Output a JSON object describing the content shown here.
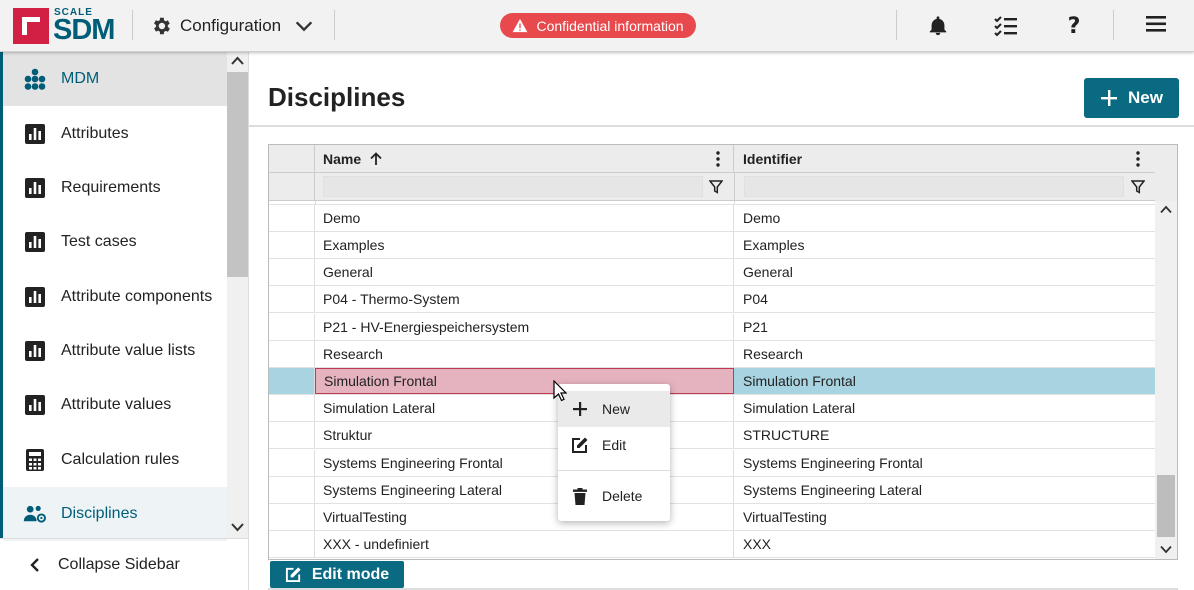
{
  "brand": {
    "scale": "SCALE",
    "sdm": "SDM",
    "color": "#005d77",
    "mark_color": "#d21f44"
  },
  "header": {
    "module_label": "Configuration",
    "confidential_label": "Confidential information",
    "icons": [
      "gear-icon",
      "chevron-down-icon",
      "warning-icon",
      "bell-icon",
      "tasks-icon",
      "help-icon",
      "menu-icon"
    ]
  },
  "sidebar": {
    "items": [
      {
        "label": "MDM",
        "icon": "sitemap-icon"
      },
      {
        "label": "Attributes",
        "icon": "chart-icon"
      },
      {
        "label": "Requirements",
        "icon": "chart-icon"
      },
      {
        "label": "Test cases",
        "icon": "chart-icon"
      },
      {
        "label": "Attribute components",
        "icon": "chart-icon"
      },
      {
        "label": "Attribute value lists",
        "icon": "chart-icon"
      },
      {
        "label": "Attribute values",
        "icon": "chart-icon"
      },
      {
        "label": "Calculation rules",
        "icon": "calculator-icon"
      },
      {
        "label": "Disciplines",
        "icon": "users-cog-icon"
      }
    ],
    "collapse_label": "Collapse Sidebar"
  },
  "main": {
    "title": "Disciplines",
    "new_button": "New",
    "edit_mode_button": "Edit mode"
  },
  "grid": {
    "columns": [
      {
        "label": "Name",
        "sort": "ascending"
      },
      {
        "label": "Identifier"
      }
    ],
    "rows": [
      {
        "name": "Demo",
        "identifier": "Demo"
      },
      {
        "name": "Examples",
        "identifier": "Examples"
      },
      {
        "name": "General",
        "identifier": "General"
      },
      {
        "name": "P04 - Thermo-System",
        "identifier": "P04"
      },
      {
        "name": "P21 - HV-Energiespeichersystem",
        "identifier": "P21"
      },
      {
        "name": "Research",
        "identifier": "Research"
      },
      {
        "name": "Simulation Frontal",
        "identifier": "Simulation Frontal"
      },
      {
        "name": "Simulation Lateral",
        "identifier": "Simulation Lateral"
      },
      {
        "name": "Struktur",
        "identifier": "STRUCTURE"
      },
      {
        "name": "Systems Engineering Frontal",
        "identifier": "Systems Engineering Frontal"
      },
      {
        "name": "Systems Engineering Lateral",
        "identifier": "Systems Engineering Lateral"
      },
      {
        "name": "VirtualTesting",
        "identifier": "VirtualTesting"
      },
      {
        "name": "XXX - undefiniert",
        "identifier": "XXX"
      }
    ],
    "selected_row": 6
  },
  "context_menu": {
    "items": [
      {
        "label": "New",
        "icon": "plus-icon"
      },
      {
        "label": "Edit",
        "icon": "edit-icon"
      },
      {
        "label": "Delete",
        "icon": "trash-icon"
      }
    ]
  }
}
